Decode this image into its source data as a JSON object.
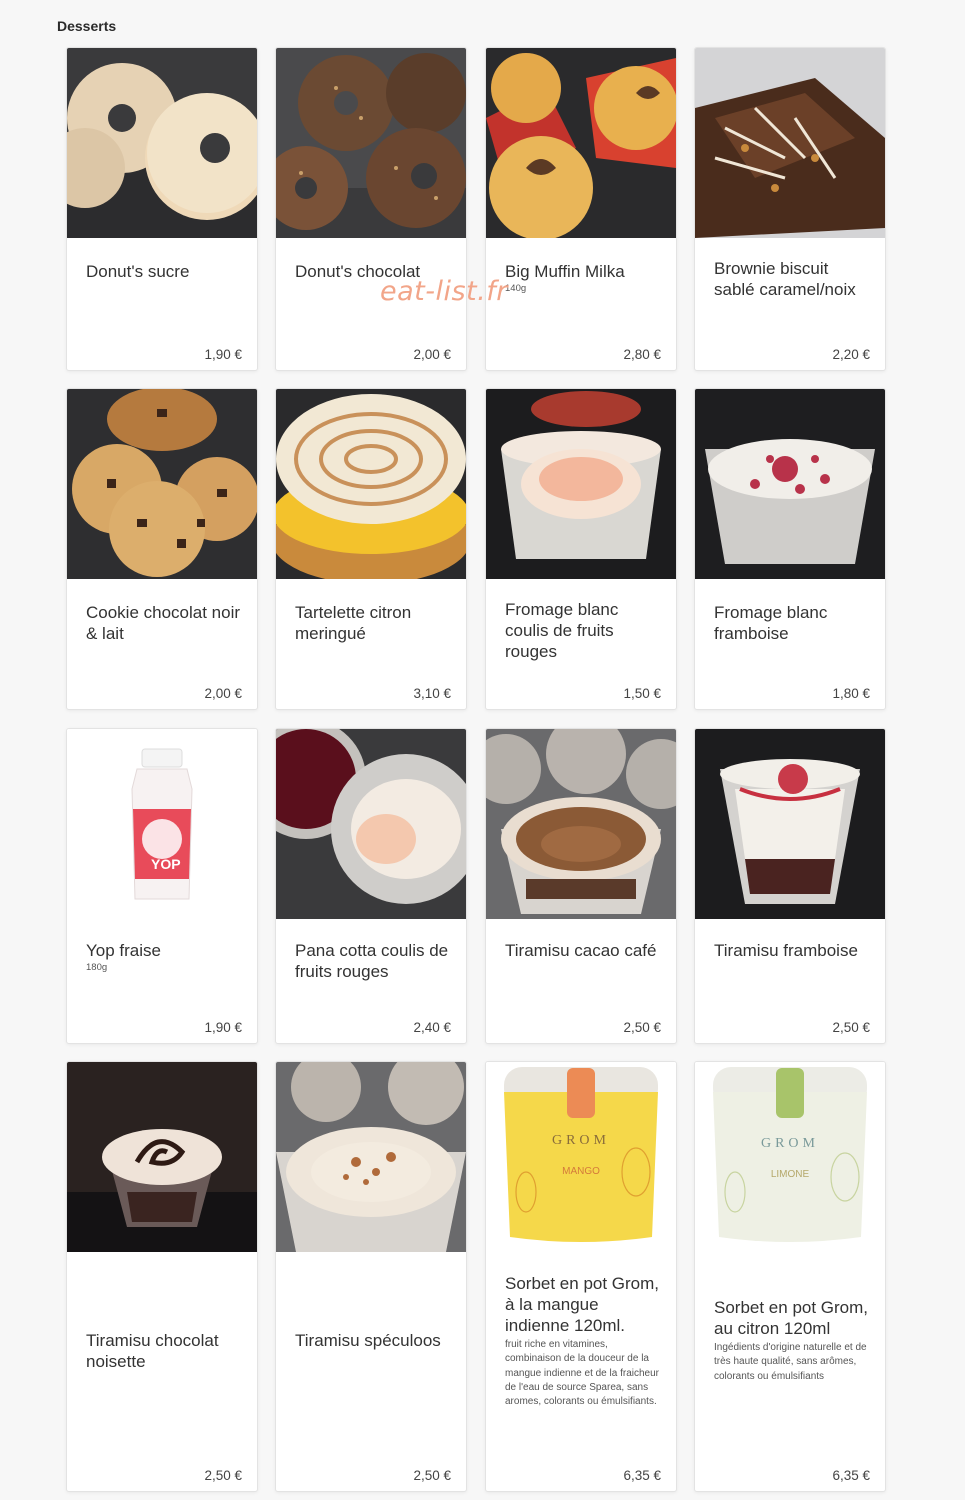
{
  "section": {
    "title": "Desserts"
  },
  "watermark": "eat-list.fr",
  "products": [
    {
      "name": "Donut's sucre",
      "weight": "",
      "description": "",
      "price": "1,90 €",
      "image": "sugar-donut-photo"
    },
    {
      "name": "Donut's chocolat",
      "weight": "",
      "description": "",
      "price": "2,00 €",
      "image": "chocolate-donut-photo"
    },
    {
      "name": "Big Muffin Milka",
      "weight": "140g",
      "description": "",
      "price": "2,80 €",
      "image": "muffin-photo"
    },
    {
      "name": "Brownie biscuit sablé caramel/noix",
      "weight": "",
      "description": "",
      "price": "2,20 €",
      "image": "brownie-photo"
    },
    {
      "name": "Cookie chocolat noir & lait",
      "weight": "",
      "description": "",
      "price": "2,00 €",
      "image": "cookie-photo"
    },
    {
      "name": "Tartelette citron meringué",
      "weight": "",
      "description": "",
      "price": "3,10 €",
      "image": "lemon-tart-photo"
    },
    {
      "name": "Fromage blanc coulis de fruits rouges",
      "weight": "",
      "description": "",
      "price": "1,50 €",
      "image": "fromage-blanc-coulis-photo"
    },
    {
      "name": "Fromage blanc framboise",
      "weight": "",
      "description": "",
      "price": "1,80 €",
      "image": "fromage-blanc-raspberry-photo"
    },
    {
      "name": "Yop fraise",
      "weight": "180g",
      "description": "",
      "price": "1,90 €",
      "image": "yop-bottle-photo"
    },
    {
      "name": "Pana cotta coulis de fruits rouges",
      "weight": "",
      "description": "",
      "price": "2,40 €",
      "image": "panna-cotta-photo"
    },
    {
      "name": "Tiramisu cacao café",
      "weight": "",
      "description": "",
      "price": "2,50 €",
      "image": "tiramisu-cacao-photo"
    },
    {
      "name": "Tiramisu framboise",
      "weight": "",
      "description": "",
      "price": "2,50 €",
      "image": "tiramisu-raspberry-photo"
    },
    {
      "name": "Tiramisu chocolat noisette",
      "weight": "",
      "description": "",
      "price": "2,50 €",
      "image": "tiramisu-chocolate-photo"
    },
    {
      "name": "Tiramisu spéculoos",
      "weight": "",
      "description": "",
      "price": "2,50 €",
      "image": "tiramisu-speculoos-photo"
    },
    {
      "name": "Sorbet en pot Grom, à la mangue indienne 120ml.",
      "weight": "",
      "description": "fruit riche en vitamines, combinaison de la douceur de la mangue indienne et de la fraicheur de l'eau de source Sparea, sans aromes, colorants ou émulsifiants.",
      "price": "6,35 €",
      "image": "grom-mango-pot-photo",
      "brand": "GROM",
      "flavor": "MANGO"
    },
    {
      "name": "Sorbet en pot Grom, au citron 120ml",
      "weight": "",
      "description": "Ingédients d'origine naturelle et de très haute qualité, sans arômes, colorants ou émulsifiants",
      "price": "6,35 €",
      "image": "grom-lemon-pot-photo",
      "brand": "GROM",
      "flavor": "LIMONE"
    }
  ]
}
